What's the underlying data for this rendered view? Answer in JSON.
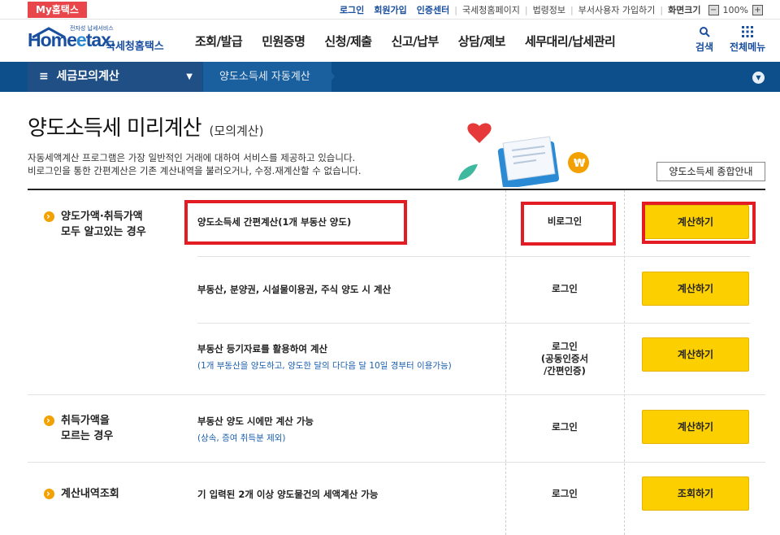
{
  "topbar": {
    "my_hometax": "My홈택스",
    "links": [
      "로그인",
      "회원가입",
      "인증센터",
      "국세청홈페이지",
      "법령정보",
      "부서사용자 가입하기",
      "화면크기"
    ],
    "zoom": "100%"
  },
  "header": {
    "logo_small": "전자성 납세서비스",
    "logo_main": "Home",
    "logo_e": "e",
    "logo_tax": "tax.",
    "logo_kr": "국세청홈택스",
    "menu": [
      "조회/발급",
      "민원증명",
      "신청/제출",
      "신고/납부",
      "상담/제보",
      "세무대리/납세관리"
    ],
    "search_label": "검색",
    "allmenu_label": "전체메뉴"
  },
  "navbar": {
    "main": "세금모의계산",
    "sub": "양도소득세 자동계산"
  },
  "page": {
    "title": "양도소득세 미리계산",
    "title_sub": "(모의계산)",
    "desc1": "자동세액계산 프로그램은 가장 일반적인 거래에 대하여 서비스를 제공하고 있습니다.",
    "desc2": "비로그인을 통한 간편계산은 기존 계산내역을 불러오거나, 수정.재계산할 수 없습니다.",
    "guide_button": "양도소득세 종합안내"
  },
  "sections": [
    {
      "category": [
        "양도가액·취득가액",
        "모두 알고있는 경우"
      ]
    },
    {
      "category": [
        "취득가액을",
        "모르는 경우"
      ]
    },
    {
      "category": [
        "계산내역조회"
      ]
    }
  ],
  "rows": [
    {
      "item": "양도소득세 간편계산(1개 부동산 양도)",
      "note": "",
      "login": "비로그인",
      "button": "계산하기"
    },
    {
      "item": "부동산, 분양권, 시설물이용권, 주식 양도 시 계산",
      "note": "",
      "login": "로그인",
      "button": "계산하기"
    },
    {
      "item": "부동산 등기자료를 활용하여 계산",
      "note": "(1개 부동산을 양도하고, 양도한 달의 다다음 달 10일 경부터 이용가능)",
      "login": "로그인\n(공동인증서\n/간편인증)",
      "button": "계산하기"
    },
    {
      "item": "부동산 양도 시에만 계산 가능",
      "note": "(상속, 증여 취득분 제외)",
      "login": "로그인",
      "button": "계산하기"
    },
    {
      "item": "기 입력된 2개 이상 양도물건의 세액계산 가능",
      "note": "",
      "login": "로그인",
      "button": "조회하기"
    }
  ],
  "colors": {
    "accent": "#0d4f8b",
    "button": "#fcd000",
    "highlight": "#e31c23",
    "bullet": "#f2a100"
  }
}
